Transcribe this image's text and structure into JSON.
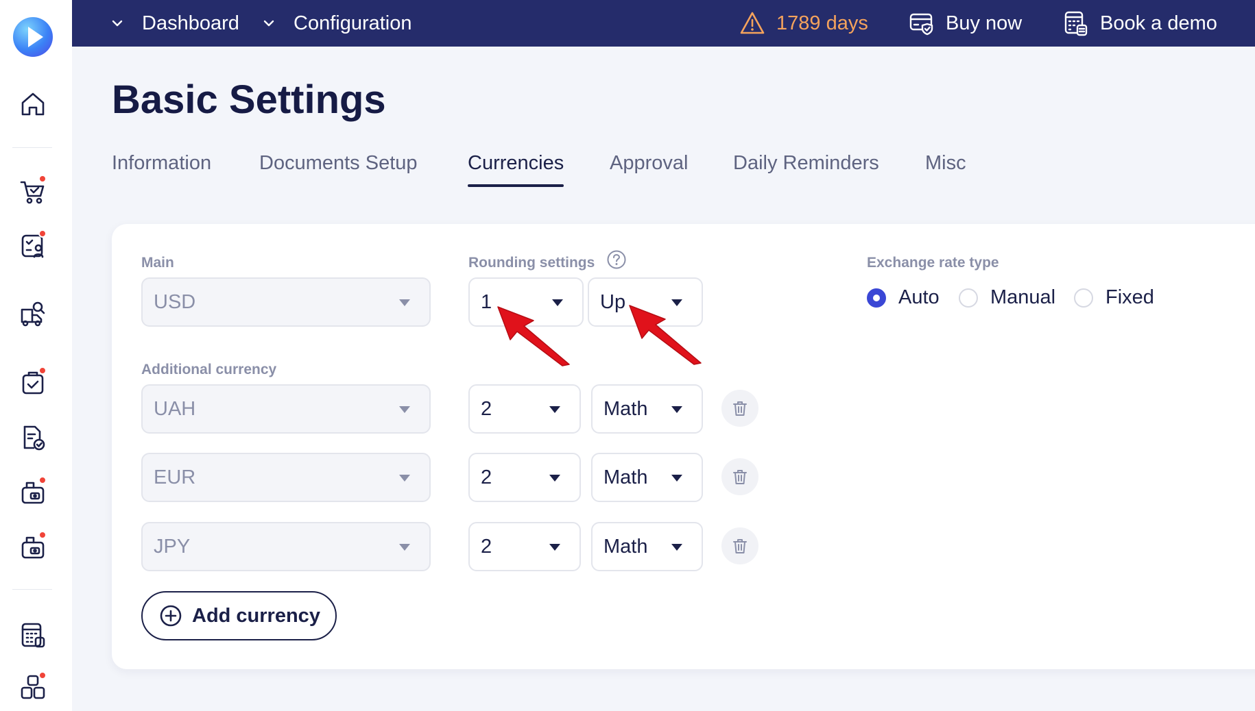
{
  "topbar": {
    "nav": [
      {
        "label": "Dashboard"
      },
      {
        "label": "Configuration"
      }
    ],
    "trial_text": "1789 days",
    "buy_now": "Buy now",
    "book_demo": "Book a demo"
  },
  "page": {
    "title": "Basic Settings"
  },
  "tabs": [
    {
      "label": "Information",
      "active": false
    },
    {
      "label": "Documents Setup",
      "active": false
    },
    {
      "label": "Currencies",
      "active": true
    },
    {
      "label": "Approval",
      "active": false
    },
    {
      "label": "Daily Reminders",
      "active": false
    },
    {
      "label": "Misc",
      "active": false
    }
  ],
  "currencies": {
    "main_label": "Main",
    "rounding_label": "Rounding settings",
    "exchange_label": "Exchange rate type",
    "additional_label": "Additional currency",
    "main": {
      "currency": "USD",
      "precision": "1",
      "mode": "Up"
    },
    "additional": [
      {
        "currency": "UAH",
        "precision": "2",
        "mode": "Math"
      },
      {
        "currency": "EUR",
        "precision": "2",
        "mode": "Math"
      },
      {
        "currency": "JPY",
        "precision": "2",
        "mode": "Math"
      }
    ],
    "exchange_options": [
      {
        "label": "Auto",
        "selected": true
      },
      {
        "label": "Manual",
        "selected": false
      },
      {
        "label": "Fixed",
        "selected": false
      }
    ],
    "add_button": "Add currency"
  },
  "colors": {
    "topbar": "#252c6b",
    "accent": "#3a47d5",
    "warning": "#f5a35c",
    "annotation_arrow": "#e0121b",
    "notification_dot": "#f04438"
  }
}
